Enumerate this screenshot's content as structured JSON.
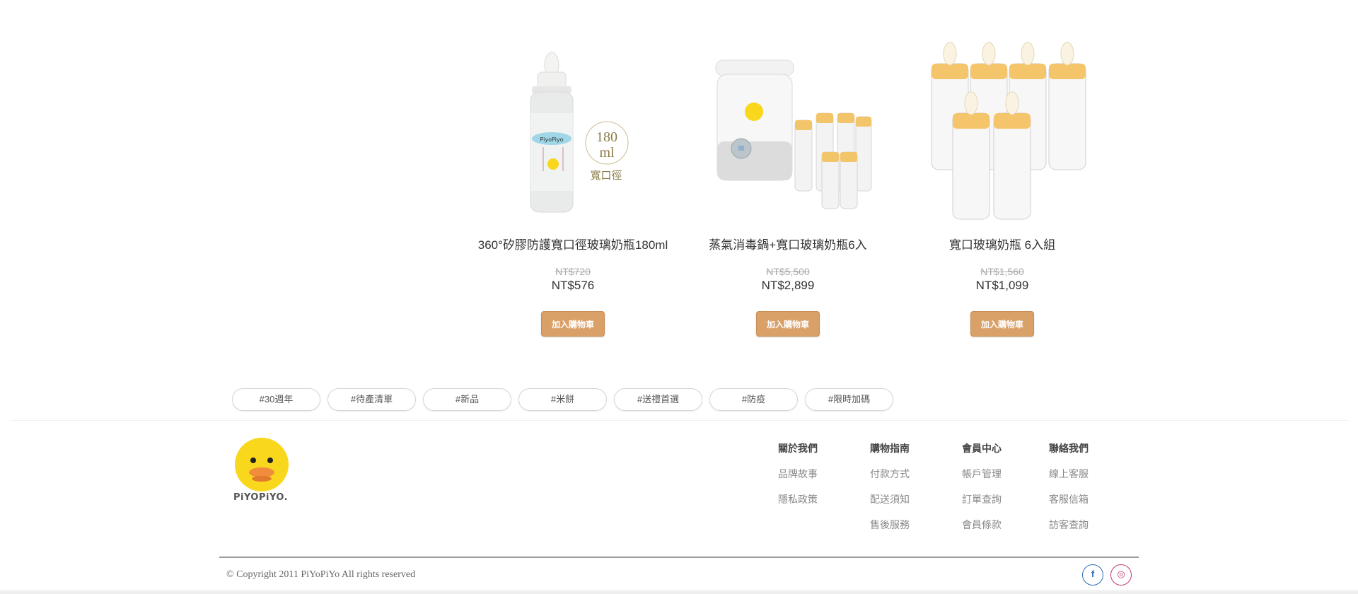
{
  "products": [
    {
      "name": "360°矽膠防護寬口徑玻璃奶瓶180ml",
      "original_price": "NT$720",
      "price": "NT$576",
      "cart_label": "加入購物車",
      "badge": {
        "volume": "180",
        "unit": "ml",
        "mouth": "寬口徑"
      },
      "bottle_brand": "PiyoPiyo"
    },
    {
      "name": "蒸氣消毒鍋+寬口玻璃奶瓶6入",
      "original_price": "NT$5,500",
      "price": "NT$2,899",
      "cart_label": "加入購物車"
    },
    {
      "name": "寬口玻璃奶瓶 6入組",
      "original_price": "NT$1,560",
      "price": "NT$1,099",
      "cart_label": "加入購物車"
    }
  ],
  "tags": [
    "#30週年",
    "#待產清單",
    "#新品",
    "#米餅",
    "#送禮首選",
    "#防疫",
    "#限時加碼"
  ],
  "footer": {
    "logo_text": "PiYOPiYO.",
    "columns": [
      {
        "title": "關於我們",
        "links": [
          "品牌故事",
          "隱私政策"
        ]
      },
      {
        "title": "購物指南",
        "links": [
          "付款方式",
          "配送須知",
          "售後服務"
        ]
      },
      {
        "title": "會員中心",
        "links": [
          "帳戶管理",
          "訂單查詢",
          "會員條款"
        ]
      },
      {
        "title": "聯絡我們",
        "links": [
          "線上客服",
          "客服信箱",
          "訪客查詢"
        ]
      }
    ],
    "copyright": "© Copyright 2011 PiYoPiYo All rights reserved",
    "social": [
      {
        "name": "facebook",
        "glyph": "f",
        "color": "#2d6cb5"
      },
      {
        "name": "instagram",
        "glyph": "◎",
        "color": "#c13a7a"
      }
    ]
  },
  "colors": {
    "cart_button": "#d9a068",
    "brand_yellow": "#f9d71c"
  }
}
